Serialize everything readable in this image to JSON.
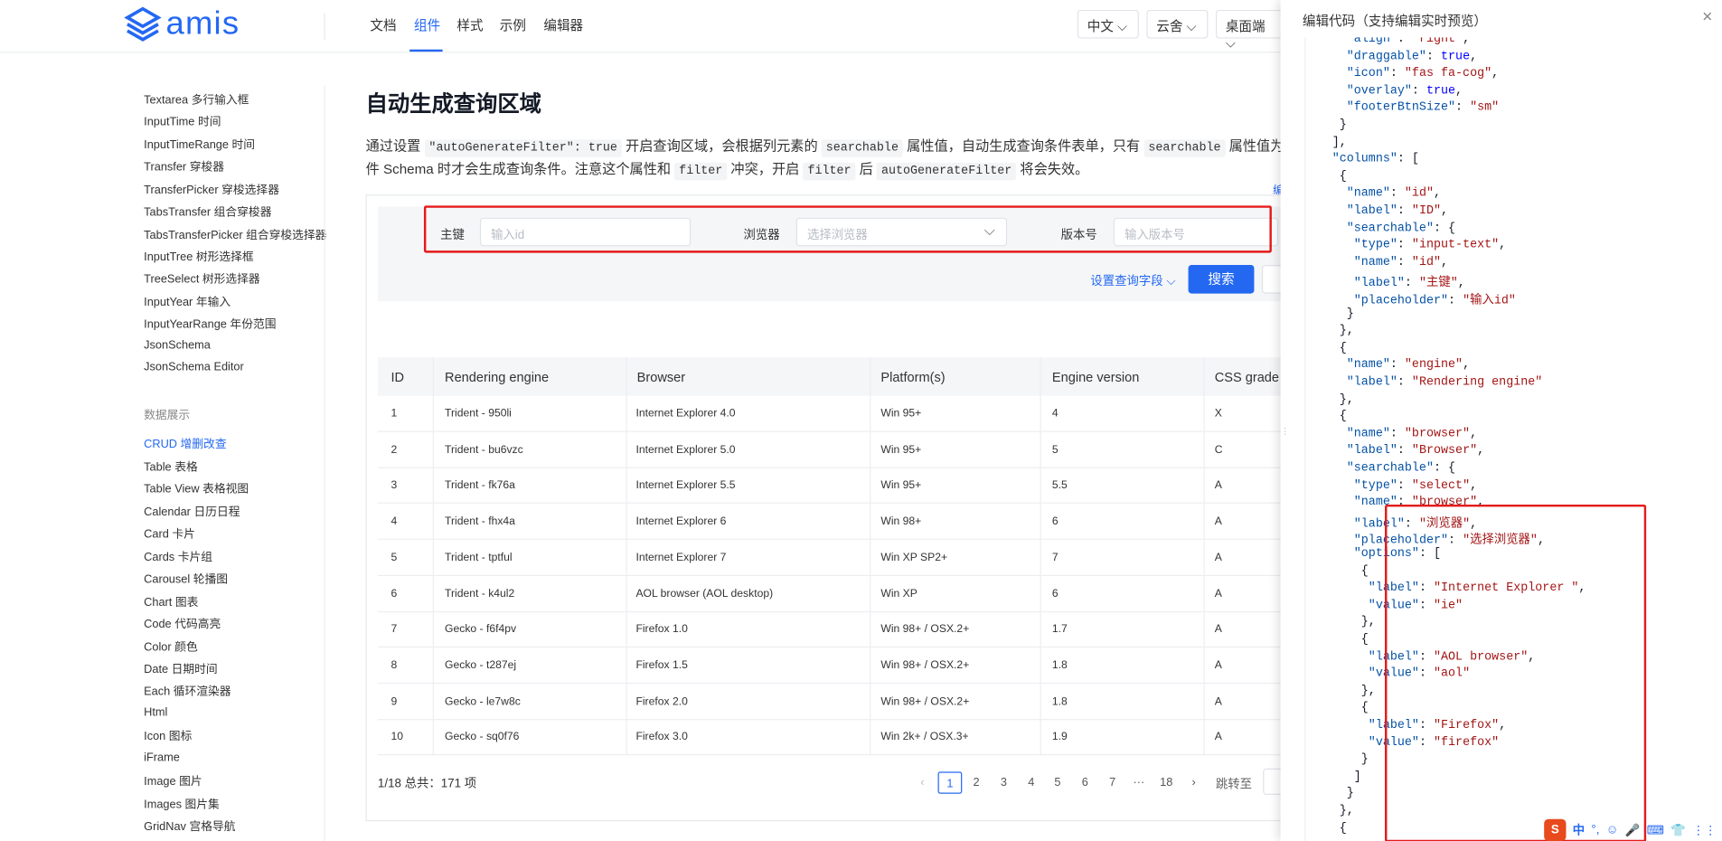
{
  "header": {
    "logo_text": "amis",
    "nav": [
      "文档",
      "组件",
      "样式",
      "示例",
      "编辑器"
    ],
    "active_nav": "组件",
    "lang": "中文",
    "cloud": "云舍",
    "platform": "桌面端"
  },
  "sidebar": {
    "items_top": [
      "Textarea 多行输入框",
      "InputTime 时间",
      "InputTimeRange 时间",
      "Transfer 穿梭器",
      "TransferPicker 穿梭选择器",
      "TabsTransfer 组合穿梭器",
      "TabsTransferPicker 组合穿梭选择器",
      "InputTree 树形选择框",
      "TreeSelect 树形选择器",
      "InputYear 年输入",
      "InputYearRange 年份范围",
      "JsonSchema",
      "JsonSchema Editor"
    ],
    "group_label": "数据展示",
    "items_bottom": [
      "CRUD 增删改查",
      "Table 表格",
      "Table View 表格视图",
      "Calendar 日历日程",
      "Card 卡片",
      "Cards 卡片组",
      "Carousel 轮播图",
      "Chart 图表",
      "Code 代码高亮",
      "Color 颜色",
      "Date 日期时间",
      "Each 循环渲染器",
      "Html",
      "Icon 图标",
      "iFrame",
      "Image 图片",
      "Images 图片集",
      "GridNav 宫格导航"
    ],
    "active": "CRUD 增删改查"
  },
  "main": {
    "title": "自动生成查询区域",
    "desc": {
      "l1_a": "通过设置",
      "l1_code1": "\"autoGenerateFilter\": true",
      "l1_b": "开启查询区域，会根据列元素的",
      "l1_code2": "searchable",
      "l1_c": "属性值，自动生成查询条件表单，只有",
      "l1_code3": "searchable",
      "l1_d": "属性值为",
      "l2_a": "件 Schema 时才会生成查询条件。注意这个属性和",
      "l2_code1": "filter",
      "l2_b": "冲突，开启",
      "l2_code2": "filter",
      "l2_c": "后",
      "l2_code3": "autoGenerateFilter",
      "l2_d": "将会失效。",
      "edge_link": "编"
    },
    "filter": {
      "id_label": "主键",
      "id_placeholder": "输入id",
      "browser_label": "浏览器",
      "browser_placeholder": "选择浏览器",
      "version_label": "版本号",
      "version_placeholder": "输入版本号",
      "config_link": "设置查询字段",
      "search_button": "搜索"
    },
    "table": {
      "columns": [
        "ID",
        "Rendering engine",
        "Browser",
        "Platform(s)",
        "Engine version",
        "CSS grade"
      ],
      "rows": [
        [
          "1",
          "Trident - 950li",
          "Internet Explorer 4.0",
          "Win 95+",
          "4",
          "X"
        ],
        [
          "2",
          "Trident - bu6vzc",
          "Internet Explorer 5.0",
          "Win 95+",
          "5",
          "C"
        ],
        [
          "3",
          "Trident - fk76a",
          "Internet Explorer 5.5",
          "Win 95+",
          "5.5",
          "A"
        ],
        [
          "4",
          "Trident - fhx4a",
          "Internet Explorer 6",
          "Win 98+",
          "6",
          "A"
        ],
        [
          "5",
          "Trident - tptful",
          "Internet Explorer 7",
          "Win XP SP2+",
          "7",
          "A"
        ],
        [
          "6",
          "Trident - k4ul2",
          "AOL browser (AOL desktop)",
          "Win XP",
          "6",
          "A"
        ],
        [
          "7",
          "Gecko - f6f4pv",
          "Firefox 1.0",
          "Win 98+ / OSX.2+",
          "1.7",
          "A"
        ],
        [
          "8",
          "Gecko - t287ej",
          "Firefox 1.5",
          "Win 98+ / OSX.2+",
          "1.8",
          "A"
        ],
        [
          "9",
          "Gecko - le7w8c",
          "Firefox 2.0",
          "Win 98+ / OSX.2+",
          "1.8",
          "A"
        ],
        [
          "10",
          "Gecko - sq0f76",
          "Firefox 3.0",
          "Win 2k+ / OSX.3+",
          "1.9",
          "A"
        ]
      ]
    },
    "pager": {
      "total": "1/18 总共：171 项",
      "pages": [
        "1",
        "2",
        "3",
        "4",
        "5",
        "6",
        "7",
        "···",
        "18"
      ],
      "current": "1",
      "prev": "‹",
      "next": "›",
      "jump_label": "跳转至"
    }
  },
  "drawer": {
    "title": "编辑代码（支持编辑实时预览）",
    "close": "×",
    "code_lines": [
      "  \"align\": \"right\",",
      "  \"draggable\": true,",
      "  \"icon\": \"fas fa-cog\",",
      "  \"overlay\": true,",
      "  \"footerBtnSize\": \"sm\"",
      " }",
      "],",
      "\"columns\": [",
      " {",
      "  \"name\": \"id\",",
      "  \"label\": \"ID\",",
      "  \"searchable\": {",
      "   \"type\": \"input-text\",",
      "   \"name\": \"id\",",
      "   \"label\": \"主键\",",
      "   \"placeholder\": \"输入id\"",
      "  }",
      " },",
      " {",
      "  \"name\": \"engine\",",
      "  \"label\": \"Rendering engine\"",
      " },",
      " {",
      "  \"name\": \"browser\",",
      "  \"label\": \"Browser\",",
      "  \"searchable\": {",
      "   \"type\": \"select\",",
      "   \"name\": \"browser\",",
      "   \"label\": \"浏览器\",",
      "   \"placeholder\": \"选择浏览器\",",
      "   \"options\": [",
      "    {",
      "     \"label\": \"Internet Explorer \",",
      "     \"value\": \"ie\"",
      "    },",
      "    {",
      "     \"label\": \"AOL browser\",",
      "     \"value\": \"aol\"",
      "    },",
      "    {",
      "     \"label\": \"Firefox\",",
      "     \"value\": \"firefox\"",
      "    }",
      "   ]",
      "  }",
      " },",
      " {"
    ],
    "ime": [
      "中",
      "°,",
      "☺",
      "🎤",
      "⌨",
      "👕",
      "⋮⋮"
    ],
    "ime_logo": "S"
  },
  "colors": {
    "accent": "#2468f2",
    "highlight": "#e51a1a"
  }
}
